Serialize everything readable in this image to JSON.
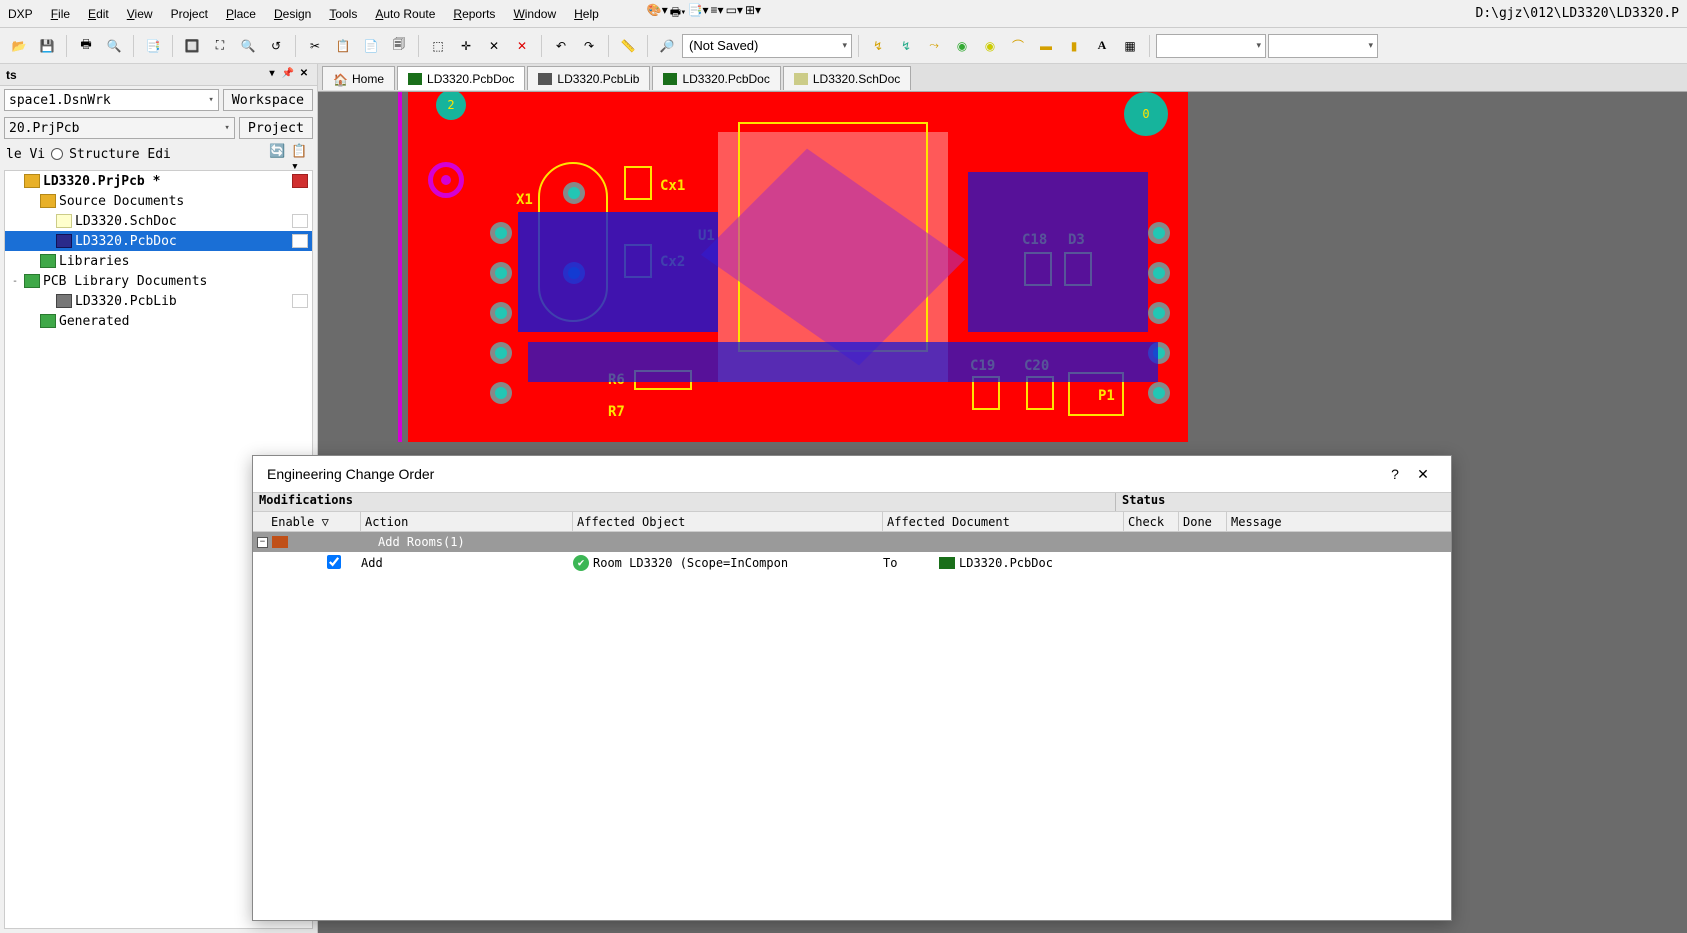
{
  "menu": {
    "items": [
      "DXP",
      "File",
      "Edit",
      "View",
      "Project",
      "Place",
      "Design",
      "Tools",
      "Auto Route",
      "Reports",
      "Window",
      "Help"
    ],
    "underlines": [
      "X",
      "F",
      "E",
      "V",
      "C",
      "P",
      "D",
      "T",
      "",
      "R",
      "W",
      "H"
    ]
  },
  "path": "D:\\gjz\\012\\LD3320\\LD3320.P",
  "toolbar": {
    "not_saved": "(Not Saved)"
  },
  "sidebar": {
    "panel_title": "ts",
    "workspace": "space1.DsnWrk",
    "workspace_btn": "Workspace",
    "project": "20.PrjPcb",
    "project_btn": "Project",
    "view_file": "le Vi",
    "view_struct": "Structure Edi",
    "tree": [
      {
        "d": 0,
        "exp": "",
        "icon": "folder-yellow",
        "label": "LD3320.PrjPcb *",
        "r": "red"
      },
      {
        "d": 1,
        "exp": "",
        "icon": "folder-yellow",
        "label": "Source Documents",
        "r": ""
      },
      {
        "d": 2,
        "exp": "",
        "icon": "sch",
        "label": "LD3320.SchDoc",
        "r": "doc"
      },
      {
        "d": 2,
        "exp": "",
        "icon": "pcb",
        "label": "LD3320.PcbDoc",
        "r": "doc",
        "sel": true
      },
      {
        "d": 1,
        "exp": "",
        "icon": "folder-green",
        "label": "Libraries",
        "r": ""
      },
      {
        "d": 0,
        "exp": "-",
        "icon": "folder-green",
        "label": "PCB Library Documents",
        "r": ""
      },
      {
        "d": 2,
        "exp": "",
        "icon": "lib",
        "label": "LD3320.PcbLib",
        "r": "doc"
      },
      {
        "d": 1,
        "exp": "",
        "icon": "folder-green",
        "label": "Generated",
        "r": ""
      }
    ]
  },
  "tabs": [
    {
      "icon": "home",
      "label": "Home"
    },
    {
      "icon": "pcb",
      "label": "LD3320.PcbDoc",
      "active": true
    },
    {
      "icon": "lib",
      "label": "LD3320.PcbLib"
    },
    {
      "icon": "pcb",
      "label": "LD3320.PcbDoc"
    },
    {
      "icon": "sch",
      "label": "LD3320.SchDoc"
    }
  ],
  "pcb": {
    "refs": {
      "x1": "X1",
      "cx1": "Cx1",
      "cx2": "Cx2",
      "u1": "U1",
      "r6": "R6",
      "r7": "R7",
      "c18": "C18",
      "d3": "D3",
      "c19": "C19",
      "c20": "C20",
      "p1": "P1",
      "n2": "2",
      "n0": "0"
    }
  },
  "eco": {
    "title": "Engineering Change Order",
    "sections": {
      "mod": "Modifications",
      "status": "Status"
    },
    "headers": {
      "enable": "Enable ▽",
      "action": "Action",
      "obj": "Affected Object",
      "doc": "Affected Document",
      "check": "Check",
      "done": "Done",
      "msg": "Message"
    },
    "group": "Add Rooms(1)",
    "row": {
      "action": "Add",
      "object": "Room LD3320 (Scope=InCompon",
      "to": "To",
      "doc": "LD3320.PcbDoc",
      "checked": true
    }
  }
}
